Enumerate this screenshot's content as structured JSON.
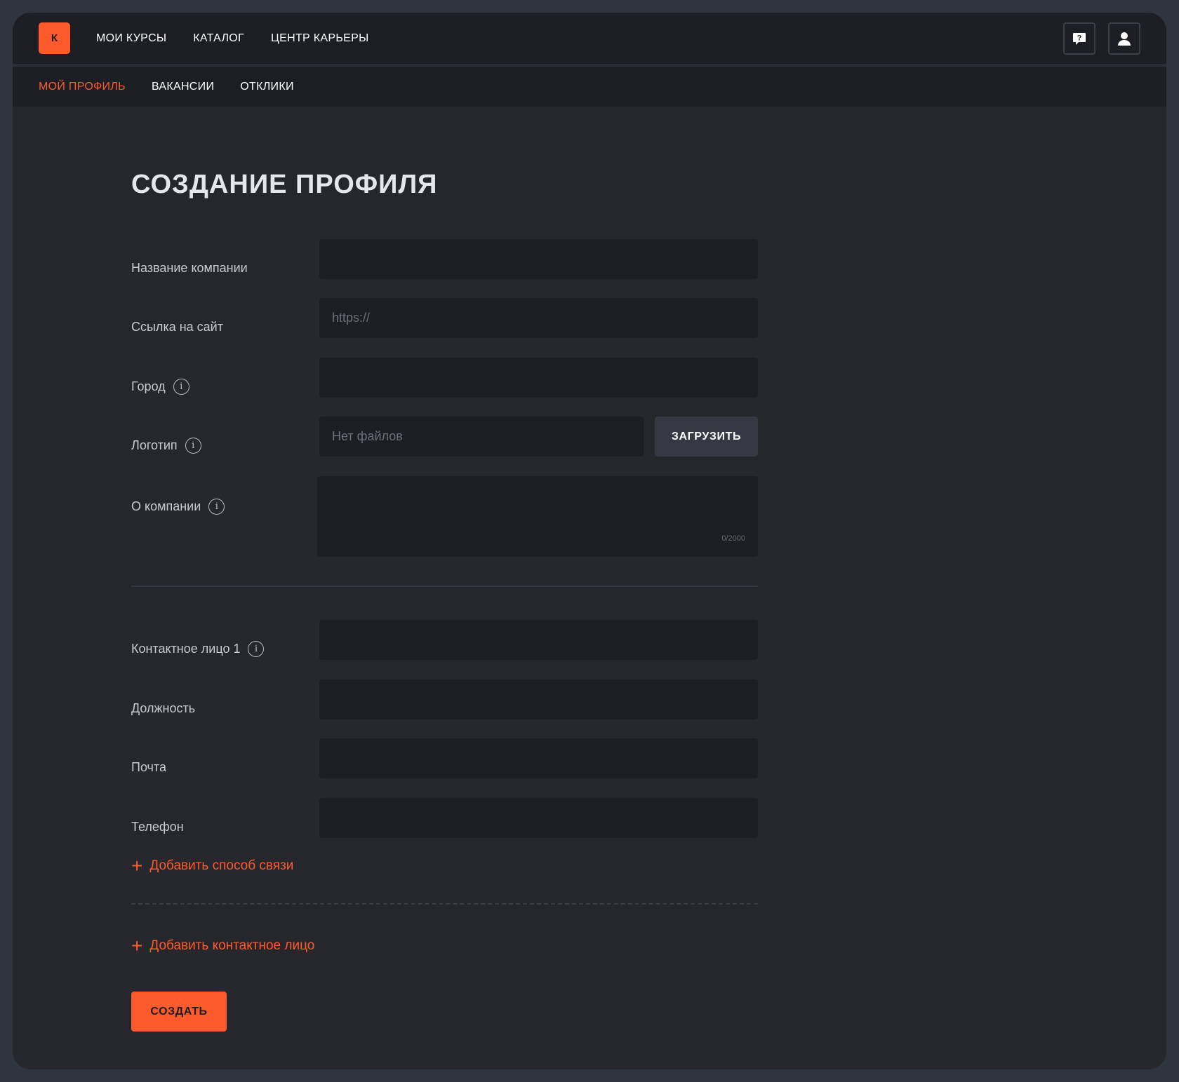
{
  "logo": {
    "letter": "К"
  },
  "main_nav": {
    "my_courses": "МОИ КУРСЫ",
    "catalog": "КАТАЛОГ",
    "career_center": "ЦЕНТР КАРЬЕРЫ"
  },
  "sub_nav": {
    "my_profile": "МОЙ ПРОФИЛЬ",
    "vacancies": "ВАКАНСИИ",
    "responses": "ОТКЛИКИ"
  },
  "page": {
    "title": "СОЗДАНИЕ ПРОФИЛЯ"
  },
  "form": {
    "company_name": {
      "label": "Название компании",
      "value": ""
    },
    "website": {
      "label": "Ссылка на сайт",
      "placeholder": "https://"
    },
    "city": {
      "label": "Город",
      "value": ""
    },
    "logo": {
      "label": "Логотип",
      "placeholder": "Нет файлов",
      "upload_label": "ЗАГРУЗИТЬ"
    },
    "about": {
      "label": "О компании",
      "counter": "0/2000"
    },
    "contact_person": {
      "label": "Контактное лицо 1",
      "value": ""
    },
    "position": {
      "label": "Должность",
      "value": ""
    },
    "email": {
      "label": "Почта",
      "value": ""
    },
    "phone": {
      "label": "Телефон",
      "value": ""
    },
    "add_contact_method": "Добавить способ связи",
    "add_contact_person": "Добавить контактное лицо",
    "submit_label": "СОЗДАТЬ"
  },
  "colors": {
    "accent": "#ff5a2c",
    "background": "#25272d",
    "surface": "#1c1e23"
  }
}
